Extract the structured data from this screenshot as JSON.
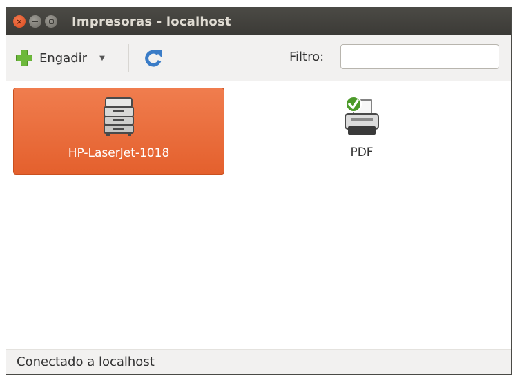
{
  "window": {
    "title": "Impresoras - localhost",
    "buttons": [
      "close-icon",
      "minimize-icon",
      "maximize-icon"
    ]
  },
  "toolbar": {
    "add_label": "Engadir",
    "add_icon": "plus-icon",
    "dropdown_icon": "dropdown-arrow-icon",
    "refresh_icon": "refresh-icon",
    "filter_label": "Filtro:",
    "filter_value": "",
    "search_icon": "search-icon",
    "clear_icon": "clear-icon"
  },
  "printers": [
    {
      "name": "HP-LaserJet-1018",
      "icon": "laser-printer-icon",
      "selected": true
    },
    {
      "name": "PDF",
      "icon": "pdf-printer-icon",
      "selected": false,
      "default_badge": "check-icon"
    }
  ],
  "status": {
    "text": "Conectado a localhost"
  },
  "colors": {
    "titlebar": "#3c3b37",
    "selection": "#e9683a",
    "toolbar_bg": "#f2f1f0",
    "title_text": "#dfdbd2"
  }
}
